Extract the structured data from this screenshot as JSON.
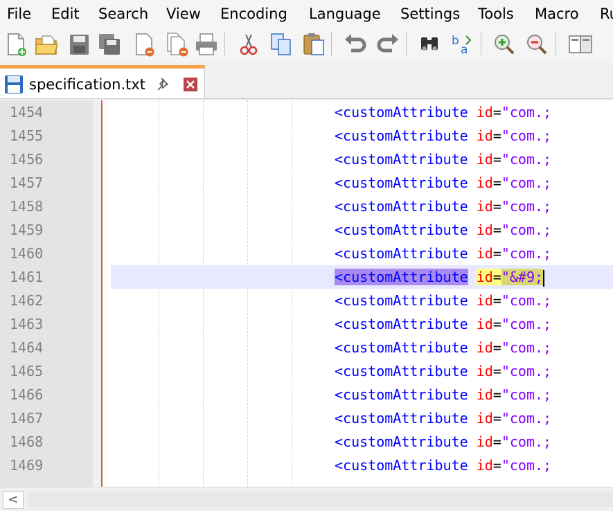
{
  "menu": [
    "File",
    "Edit",
    "Search",
    "View",
    "Encoding",
    "Language",
    "Settings",
    "Tools",
    "Macro",
    "Ru"
  ],
  "toolbar": {
    "icons": [
      "new-file-icon",
      "open-file-icon",
      "save-icon",
      "save-all-icon",
      "close-icon",
      "close-all-icon",
      "print-icon",
      "cut-icon",
      "copy-icon",
      "paste-icon",
      "undo-icon",
      "redo-icon",
      "find-icon",
      "replace-icon",
      "zoom-in-icon",
      "zoom-out-icon",
      "sync-scroll-icon"
    ]
  },
  "tab": {
    "title": "specification.txt"
  },
  "editor": {
    "current_line": "1461",
    "lines": [
      {
        "num": "1454",
        "tag": "<customAttribute",
        "attr": "id",
        "eq": "=",
        "val": "\"com.;"
      },
      {
        "num": "1455",
        "tag": "<customAttribute",
        "attr": "id",
        "eq": "=",
        "val": "\"com.;"
      },
      {
        "num": "1456",
        "tag": "<customAttribute",
        "attr": "id",
        "eq": "=",
        "val": "\"com.;"
      },
      {
        "num": "1457",
        "tag": "<customAttribute",
        "attr": "id",
        "eq": "=",
        "val": "\"com.;"
      },
      {
        "num": "1458",
        "tag": "<customAttribute",
        "attr": "id",
        "eq": "=",
        "val": "\"com.;"
      },
      {
        "num": "1459",
        "tag": "<customAttribute",
        "attr": "id",
        "eq": "=",
        "val": "\"com.;"
      },
      {
        "num": "1460",
        "tag": "<customAttribute",
        "attr": "id",
        "eq": "=",
        "val": "\"com.;"
      },
      {
        "num": "1461",
        "tag": "<customAttribute",
        "attr": "id",
        "eq": "=",
        "val": "\"&#9;"
      },
      {
        "num": "1462",
        "tag": "<customAttribute",
        "attr": "id",
        "eq": "=",
        "val": "\"com.;"
      },
      {
        "num": "1463",
        "tag": "<customAttribute",
        "attr": "id",
        "eq": "=",
        "val": "\"com.;"
      },
      {
        "num": "1464",
        "tag": "<customAttribute",
        "attr": "id",
        "eq": "=",
        "val": "\"com.;"
      },
      {
        "num": "1465",
        "tag": "<customAttribute",
        "attr": "id",
        "eq": "=",
        "val": "\"com.;"
      },
      {
        "num": "1466",
        "tag": "<customAttribute",
        "attr": "id",
        "eq": "=",
        "val": "\"com.;"
      },
      {
        "num": "1467",
        "tag": "<customAttribute",
        "attr": "id",
        "eq": "=",
        "val": "\"com.;"
      },
      {
        "num": "1468",
        "tag": "<customAttribute",
        "attr": "id",
        "eq": "=",
        "val": "\"com.;"
      },
      {
        "num": "1469",
        "tag": "<customAttribute",
        "attr": "id",
        "eq": "=",
        "val": "\"com.;"
      }
    ]
  },
  "colors": {
    "tab_accent": "#f6a447",
    "tag": "#0000ff",
    "attribute": "#ff0000",
    "value": "#8000ff",
    "current_line": "#e8e8ff",
    "edge_line": "#d85a4a"
  }
}
